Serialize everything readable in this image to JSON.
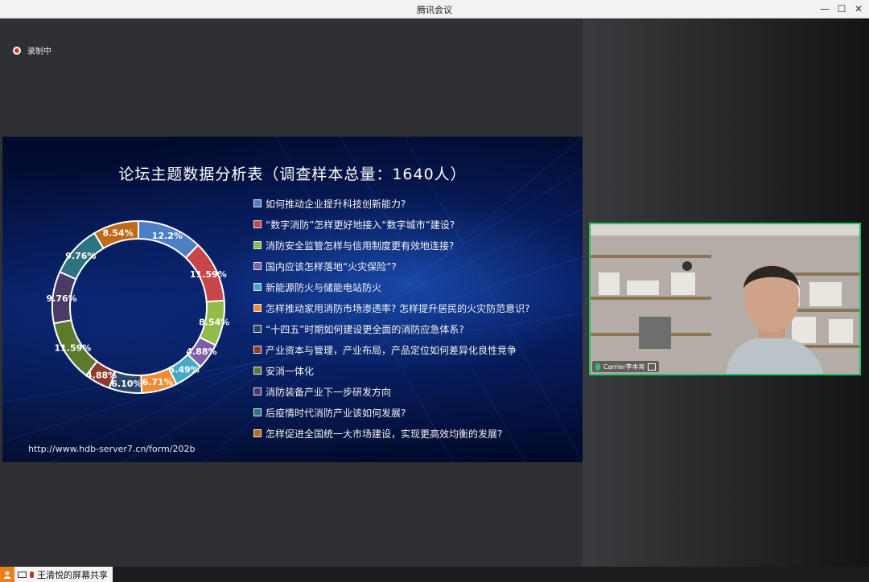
{
  "window": {
    "title": "腾讯会议"
  },
  "controls": {
    "minimize": "—",
    "maximize": "☐",
    "close": "✕"
  },
  "recording": {
    "label": "录制中"
  },
  "slide": {
    "title": "论坛主题数据分析表（调查样本总量：1640人）",
    "url": "http://www.hdb-server7.cn/form/202b",
    "legend": [
      {
        "label": "如何推动企业提升科技创新能力?",
        "color": "#4e7fc4"
      },
      {
        "label": "“数字消防”怎样更好地接入“数字城市”建设?",
        "color": "#c8464a"
      },
      {
        "label": "消防安全监管怎样与信用制度更有效地连接?",
        "color": "#94bb4a"
      },
      {
        "label": "国内应该怎样落地“火灾保险”?",
        "color": "#7e5fa6"
      },
      {
        "label": "新能源防火与储能电站防火",
        "color": "#43a9c4"
      },
      {
        "label": "怎样推动家用消防市场渗透率? 怎样提升居民的火灾防范意识?",
        "color": "#f08c34"
      },
      {
        "label": "“十四五”时期如何建设更全面的消防应急体系?",
        "color": "#2b4667"
      },
      {
        "label": "产业资本与管理，产业布局，产品定位如何差异化良性竞争",
        "color": "#8f3b2c"
      },
      {
        "label": "安消一体化",
        "color": "#5c7a2e"
      },
      {
        "label": "消防装备产业下一步研发方向",
        "color": "#4a3a66"
      },
      {
        "label": "后疫情时代消防产业该如何发展?",
        "color": "#2c7480"
      },
      {
        "label": "怎样促进全国统一大市场建设，实现更高效均衡的发展?",
        "color": "#c06a18"
      }
    ]
  },
  "chart_data": {
    "type": "pie",
    "title": "论坛主题数据分析表（调查样本总量：1640人）",
    "values": [
      12.2,
      11.59,
      8.54,
      4.88,
      5.49,
      6.71,
      6.1,
      4.88,
      11.59,
      9.76,
      9.76,
      8.54
    ],
    "value_labels": [
      "12.2%",
      "11.59%",
      "8.54%",
      "4.88%",
      "5.49%",
      "6.71%",
      "6.10%",
      "4.88%",
      "11.59%",
      "9.76%",
      "9.76%",
      "8.54%"
    ],
    "colors": [
      "#4e7fc4",
      "#c8464a",
      "#94bb4a",
      "#7e5fa6",
      "#43a9c4",
      "#f08c34",
      "#2b4667",
      "#8f3b2c",
      "#5c7a2e",
      "#4a3a66",
      "#2c7480",
      "#c06a18"
    ],
    "legend_position": "right"
  },
  "video": {
    "name": "Carrier李本亮"
  },
  "share": {
    "label": "王清悦的屏幕共享"
  }
}
